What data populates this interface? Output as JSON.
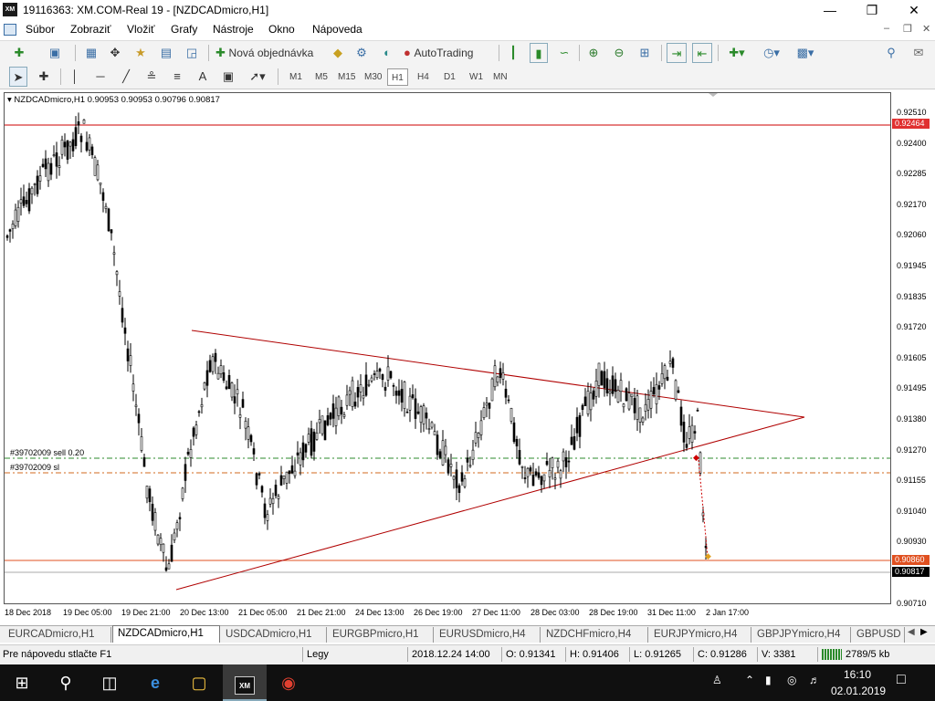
{
  "window": {
    "title": "19116363: XM.COM-Real 19 - [NZDCADmicro,H1]",
    "logo": "XM",
    "minimize_glyph": "—",
    "maximize_glyph": "❐",
    "close_glyph": "✕"
  },
  "menu": [
    "Súbor",
    "Zobraziť",
    "Vložiť",
    "Grafy",
    "Nástroje",
    "Okno",
    "Nápoveda"
  ],
  "toolbar": {
    "new_order_label": "Nová objednávka",
    "autotrading_label": "AutoTrading"
  },
  "timeframes": [
    "M1",
    "M5",
    "M15",
    "M30",
    "H1",
    "H4",
    "D1",
    "W1",
    "MN"
  ],
  "selected_timeframe": "H1",
  "chart": {
    "info": "NZDCADmicro,H1  0.90953 0.90953 0.90796 0.90817",
    "order_label": "#39702009 sell 0.20",
    "sl_label": "#39702009 sl",
    "price_labels": [
      "0.92510",
      "0.92400",
      "0.92285",
      "0.92170",
      "0.92060",
      "0.91945",
      "0.91835",
      "0.91720",
      "0.91605",
      "0.91495",
      "0.91380",
      "0.91270",
      "0.91155",
      "0.91040",
      "0.90930",
      "0.90820",
      "0.90710"
    ],
    "tag_top": "0.92464",
    "tag_support": "0.90860",
    "tag_bid": "0.90817",
    "time_labels": [
      "18 Dec 2018",
      "19 Dec 05:00",
      "19 Dec 21:00",
      "20 Dec 13:00",
      "21 Dec 05:00",
      "21 Dec 21:00",
      "24 Dec 13:00",
      "26 Dec 19:00",
      "27 Dec 11:00",
      "28 Dec 03:00",
      "28 Dec 19:00",
      "31 Dec 11:00",
      "2 Jan 17:00"
    ],
    "colors": {
      "resistance": "#cc0000",
      "triangle": "#b00000",
      "order": "#2e8b2e",
      "sl": "#d2691e",
      "support": "#e05020"
    }
  },
  "tabs": [
    "EURCADmicro,H1",
    "NZDCADmicro,H1",
    "USDCADmicro,H1",
    "EURGBPmicro,H1",
    "EURUSDmicro,H4",
    "NZDCHFmicro,H4",
    "EURJPYmicro,H4",
    "GBPJPYmicro,H4",
    "GBPUSD"
  ],
  "active_tab": "NZDCADmicro,H1",
  "status": {
    "help": "Pre nápovedu stlačte F1",
    "profile": "Legy",
    "datetime": "2018.12.24 14:00",
    "open": "O: 0.91341",
    "high": "H: 0.91406",
    "low": "L: 0.91265",
    "close": "C: 0.91286",
    "volume": "V: 3381",
    "traffic": "2789/5 kb"
  },
  "taskbar": {
    "time": "16:10",
    "date": "02.01.2019"
  }
}
